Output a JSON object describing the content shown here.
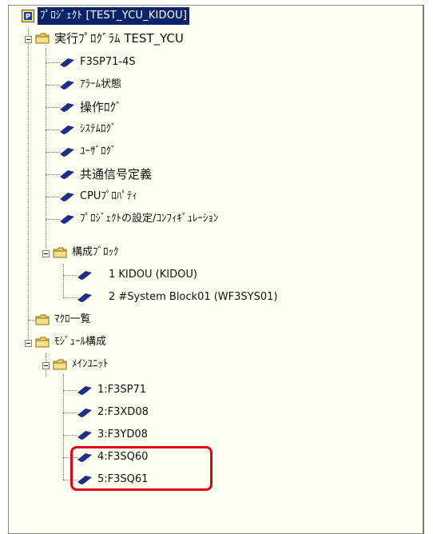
{
  "tree": {
    "root": "ﾌﾟﾛｼﾞｪｸﾄ [TEST_YCU_KIDOU]",
    "exec_folder": "実行ﾌﾟﾛｸﾞﾗﾑ TEST_YCU",
    "exec_items": [
      "F3SP71-4S",
      "ｱﾗｰﾑ状態",
      "操作ﾛｸﾞ",
      "ｼｽﾃﾑﾛｸﾞ",
      "ﾕｰｻﾞﾛｸﾞ",
      "共通信号定義",
      "CPUﾌﾟﾛﾊﾟﾃｨ",
      "ﾌﾟﾛｼﾞｪｸﾄの設定/ｺﾝﾌｨｷﾞｭﾚｰｼｮﾝ"
    ],
    "block_folder": "構成ﾌﾞﾛｯｸ",
    "block_items": [
      "1 KIDOU (KIDOU)",
      "2 #System Block01 (WF3SYS01)"
    ],
    "macro_folder": "ﾏｸﾛ一覧",
    "module_folder": "ﾓｼﾞｭｰﾙ構成",
    "main_unit_folder": "ﾒｲﾝﾕﾆｯﾄ",
    "unit_items": [
      "1:F3SP71",
      "2:F3XD08",
      "3:F3YD08",
      "4:F3SQ60",
      "5:F3SQ61"
    ]
  },
  "colors": {
    "panel_background": "#fffff0",
    "selection": "#0a246a",
    "highlight_box": "#e2001a"
  }
}
